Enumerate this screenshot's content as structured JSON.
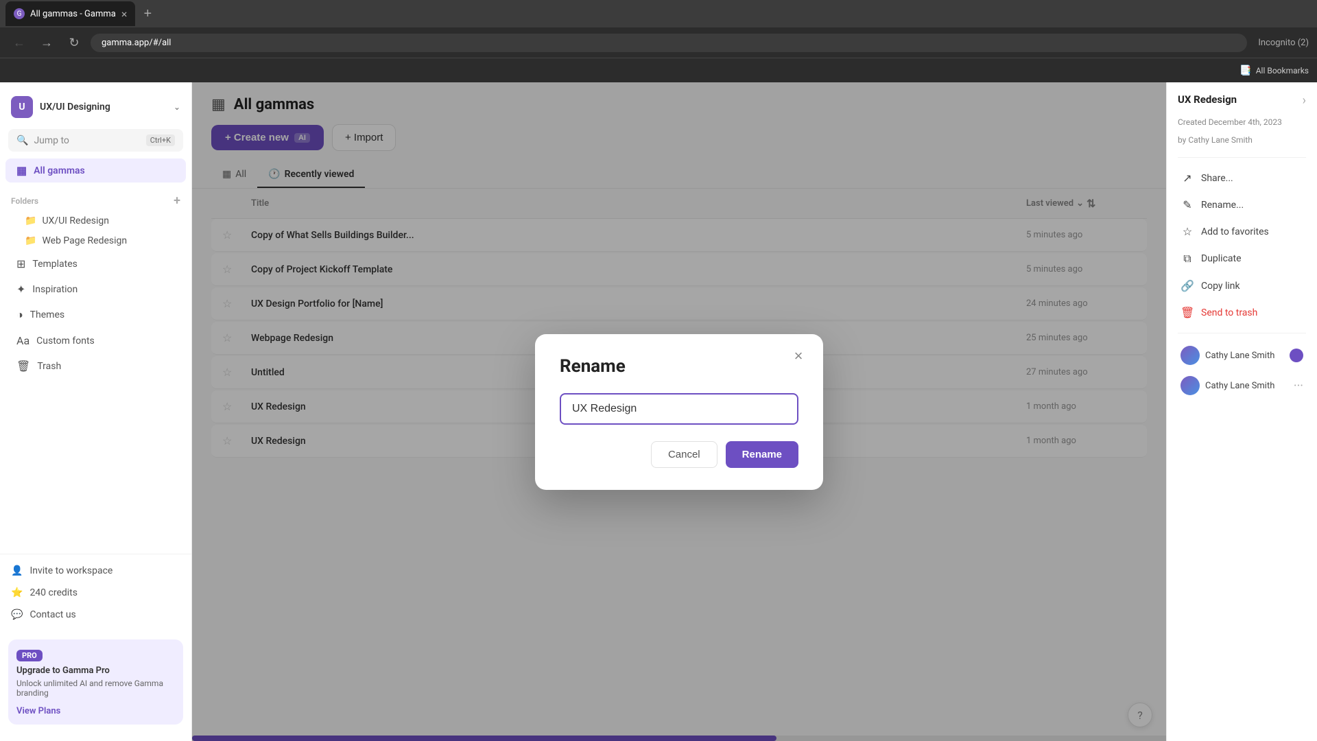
{
  "browser": {
    "tab_title": "All gammas - Gamma",
    "url": "gamma.app/#/all",
    "tab_close": "×",
    "new_tab": "+",
    "bookmarks_label": "All Bookmarks",
    "incognito_label": "Incognito (2)"
  },
  "sidebar": {
    "workspace_initial": "U",
    "workspace_name": "UX/UI Designing",
    "search_placeholder": "Jump to",
    "search_shortcut": "Ctrl+K",
    "nav_items": [
      {
        "id": "all-gammas",
        "label": "All gammas",
        "active": true
      },
      {
        "id": "templates",
        "label": "Templates",
        "active": false
      },
      {
        "id": "inspiration",
        "label": "Inspiration",
        "active": false
      },
      {
        "id": "themes",
        "label": "Themes",
        "active": false
      },
      {
        "id": "custom-fonts",
        "label": "Custom fonts",
        "active": false
      },
      {
        "id": "trash",
        "label": "Trash",
        "active": false
      }
    ],
    "folders_section": "Folders",
    "folders": [
      {
        "id": "ux-ui-redesign",
        "label": "UX/UI Redesign"
      },
      {
        "id": "web-page-redesign",
        "label": "Web Page Redesign"
      }
    ],
    "bottom_items": [
      {
        "id": "invite",
        "label": "Invite to workspace"
      },
      {
        "id": "credits",
        "label": "240 credits"
      },
      {
        "id": "contact",
        "label": "Contact us"
      }
    ],
    "upgrade": {
      "badge": "PRO",
      "title": "Upgrade to Gamma Pro",
      "description": "Unlock unlimited AI and remove Gamma branding",
      "link": "View Plans"
    }
  },
  "main": {
    "page_title": "All gammas",
    "create_btn": "+ Create new",
    "ai_badge": "AI",
    "import_btn": "+ Import",
    "tabs": [
      {
        "id": "all",
        "label": "All",
        "active": false
      },
      {
        "id": "recently-viewed",
        "label": "Recently viewed",
        "active": true
      }
    ],
    "table_headers": {
      "title": "Title",
      "last_viewed": "Last viewed"
    },
    "rows": [
      {
        "id": "1",
        "title": "Copy of What Sells Buildings Builder...",
        "time": "5 minutes ago"
      },
      {
        "id": "2",
        "title": "Copy of Project Kickoff Template",
        "time": "5 minutes ago"
      },
      {
        "id": "3",
        "title": "UX Design Portfolio for [Name]",
        "time": "24 minutes ago"
      },
      {
        "id": "4",
        "title": "Webpage Redesign",
        "time": "25 minutes ago"
      },
      {
        "id": "5",
        "title": "Untitled",
        "time": "27 minutes ago"
      },
      {
        "id": "6",
        "title": "UX Redesign",
        "time": "1 month ago"
      },
      {
        "id": "7",
        "title": "UX Redesign",
        "time": "1 month ago"
      }
    ]
  },
  "right_panel": {
    "title": "UX Redesign",
    "created": "Created December 4th, 2023",
    "created_by": "by Cathy Lane Smith",
    "context_menu": [
      {
        "id": "share",
        "label": "Share...",
        "icon": "↗",
        "danger": false
      },
      {
        "id": "rename",
        "label": "Rename...",
        "icon": "✎",
        "danger": false
      },
      {
        "id": "add-favorites",
        "label": "Add to favorites",
        "icon": "☆",
        "danger": false
      },
      {
        "id": "duplicate",
        "label": "Duplicate",
        "icon": "⧉",
        "danger": false
      },
      {
        "id": "copy-link",
        "label": "Copy link",
        "icon": "🔗",
        "danger": false
      },
      {
        "id": "send-to-trash",
        "label": "Send to trash",
        "icon": "🗑",
        "danger": true
      }
    ],
    "shared_users": [
      {
        "id": "user1",
        "name": "Cathy Lane Smith",
        "has_badge": true
      },
      {
        "id": "user2",
        "name": "Cathy Lane Smith",
        "has_badge": false
      }
    ]
  },
  "modal": {
    "title": "Rename",
    "input_value": "UX Redesign",
    "cancel_label": "Cancel",
    "rename_label": "Rename"
  },
  "help_btn": "?"
}
